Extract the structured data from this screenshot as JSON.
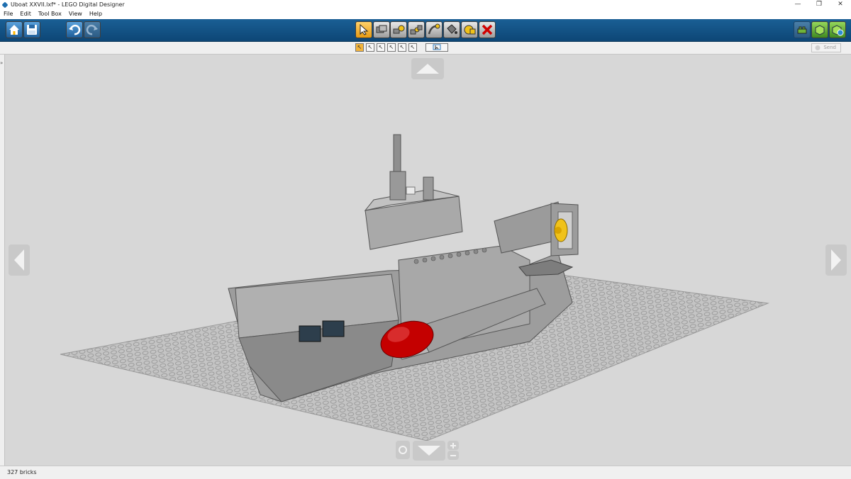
{
  "window": {
    "title": "Uboat XXVII.lxf* - LEGO Digital Designer"
  },
  "menu": [
    "File",
    "Edit",
    "Tool Box",
    "View",
    "Help"
  ],
  "toolbar": {
    "left": [
      {
        "name": "home-button",
        "icon": "home-icon"
      },
      {
        "name": "save-button",
        "icon": "save-icon"
      },
      {
        "name": "undo-button",
        "icon": "undo-icon"
      },
      {
        "name": "redo-button",
        "icon": "redo-icon"
      }
    ],
    "tools": [
      {
        "name": "select-tool-button",
        "icon": "cursor-icon",
        "active": true
      },
      {
        "name": "clone-tool-button",
        "icon": "clone-icon"
      },
      {
        "name": "hinge-tool-button",
        "icon": "hinge-icon"
      },
      {
        "name": "hinge-align-tool-button",
        "icon": "hinge-align-icon"
      },
      {
        "name": "flex-tool-button",
        "icon": "flex-icon"
      },
      {
        "name": "paint-tool-button",
        "icon": "paint-bucket-icon"
      },
      {
        "name": "hide-tool-button",
        "icon": "hide-icon"
      },
      {
        "name": "delete-tool-button",
        "icon": "delete-icon"
      }
    ],
    "modes": [
      {
        "name": "build-mode-button",
        "icon": "build-mode-icon"
      },
      {
        "name": "view-mode-button",
        "icon": "view-mode-icon"
      },
      {
        "name": "building-guide-mode-button",
        "icon": "building-guide-icon"
      }
    ]
  },
  "subtoolbar": {
    "select_modes": [
      "single",
      "connected",
      "same-color",
      "same-brick",
      "same-color-brick",
      "invert"
    ],
    "send_label": "Send"
  },
  "sidebar": {
    "toggle_glyph": "»"
  },
  "status": {
    "brick_count": "327 bricks"
  },
  "colors": {
    "toolbar": "#1a5f95",
    "viewport": "#d7d7d7",
    "brick_gray": "#a0a0a0",
    "torpedo_red": "#c00000",
    "propeller_yellow": "#f0c21a",
    "accent": "#f3b43b"
  }
}
